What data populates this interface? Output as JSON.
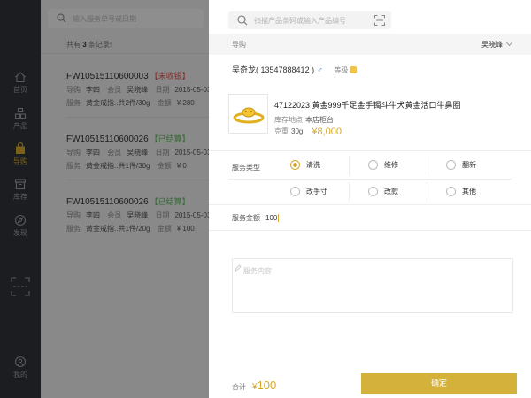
{
  "nav": {
    "items": [
      {
        "label": "首页",
        "icon": "home-icon"
      },
      {
        "label": "产品",
        "icon": "product-icon"
      },
      {
        "label": "导购",
        "icon": "shopping-bag-icon",
        "active": true
      },
      {
        "label": "库存",
        "icon": "inventory-icon"
      },
      {
        "label": "发现",
        "icon": "compass-icon"
      }
    ],
    "scan_icon": "scan-frame-icon",
    "me_label": "我的",
    "accent": "#d4a72c"
  },
  "list": {
    "search_placeholder": "输入服务单号或日期",
    "count_prefix": "共有",
    "count": "3",
    "count_suffix": "条记录!",
    "records": [
      {
        "no": "FW10515110600003",
        "status": "【未收银】",
        "status_color": "red",
        "guide_label": "导购",
        "guide": "李四",
        "member_label": "会员",
        "member": "吴晓峰",
        "date_label": "日期",
        "date": "2015-05-03",
        "service_label": "服务",
        "service": "黄金戒指..共2件/30g",
        "amount_label": "金额",
        "amount": "¥ 280"
      },
      {
        "no": "FW10515110600026",
        "status": "【已结算】",
        "status_color": "green",
        "guide_label": "导购",
        "guide": "李四",
        "member_label": "会员",
        "member": "吴晓峰",
        "date_label": "日期",
        "date": "2015-05-03",
        "service_label": "服务",
        "service": "黄金戒指..共1件/30g",
        "amount_label": "金额",
        "amount": "¥ 0"
      },
      {
        "no": "FW10515110600026",
        "status": "【已结算】",
        "status_color": "green",
        "guide_label": "导购",
        "guide": "李四",
        "member_label": "会员",
        "member": "吴晓峰",
        "date_label": "日期",
        "date": "2015-05-03",
        "service_label": "服务",
        "service": "黄金戒指..共1件/20g",
        "amount_label": "金额",
        "amount": "¥ 100"
      }
    ]
  },
  "detail": {
    "search_placeholder": "扫描产品条码或输入产品编号",
    "guide_label": "导购",
    "guide_value": "吴晓峰",
    "member_name": "吴奇龙",
    "member_phone": "( 13547888412 )",
    "member_gender": "♂",
    "level_label": "等级",
    "product": {
      "title": "47122023 黄金999千足金手镯斗牛犬黄金活口牛鼻圈",
      "location_label": "库存地点",
      "location": "本店柜台",
      "weight_label": "克重",
      "weight": "30g",
      "price": "¥8,000"
    },
    "service_type_label": "服务类型",
    "service_types": [
      {
        "label": "清洗",
        "selected": true
      },
      {
        "label": "维修",
        "selected": false
      },
      {
        "label": "翻新",
        "selected": false
      },
      {
        "label": "改手寸",
        "selected": false
      },
      {
        "label": "改款",
        "selected": false
      },
      {
        "label": "其他",
        "selected": false
      }
    ],
    "amount_label": "服务金额",
    "amount_value": "100",
    "memo_placeholder": "服务内容",
    "total_label": "合计",
    "total_currency": "¥",
    "total_value": "100",
    "confirm_label": "确定"
  }
}
